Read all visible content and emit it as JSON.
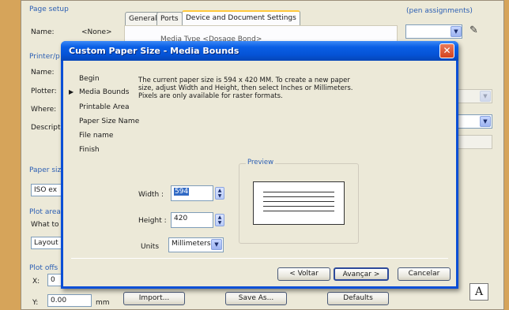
{
  "parent": {
    "page_setup": {
      "group_title": "Page setup",
      "name_label": "Name:",
      "name_value": "<None>"
    },
    "tabs": [
      "General",
      "Ports",
      "Device and Document Settings"
    ],
    "media_type_text": "Media Type <Dosage Bond>",
    "printer_group": {
      "title": "Printer/p",
      "name_label": "Name:",
      "plotter_label": "Plotter:",
      "where_label": "Where:",
      "description_label": "Descript"
    },
    "paper_size": {
      "title": "Paper siz",
      "value": "ISO ex"
    },
    "plot_area": {
      "title": "Plot area",
      "what_label": "What to",
      "value": "Layout"
    },
    "plot_offset": {
      "title": "Plot offs",
      "x_label": "X:",
      "x_value": "0",
      "y_label": "Y:",
      "y_value": "0.00",
      "unit": "mm"
    },
    "pen_assignments_title": "(pen assignments)",
    "buttons": {
      "import": "Import...",
      "save_as": "Save As...",
      "defaults": "Defaults"
    },
    "right_a_glyph": "A"
  },
  "dialog": {
    "title": "Custom Paper Size - Media Bounds",
    "close_glyph": "✕",
    "steps": [
      "Begin",
      "Media Bounds",
      "Printable Area",
      "Paper Size Name",
      "File name",
      "Finish"
    ],
    "current_step_arrow": "▶",
    "description": "The current paper size is 594 x 420 MM. To create a new paper size, adjust Width and Height, then select Inches or Millimeters. Pixels are only available for raster formats.",
    "width_label": "Width :",
    "width_value": "594",
    "height_label": "Height :",
    "height_value": "420",
    "units_label": "Units",
    "units_value": "Millimeters",
    "preview_label": "Preview",
    "buttons": {
      "back": "< Voltar",
      "next": "Avançar >",
      "cancel": "Cancelar"
    }
  },
  "colors": {
    "title_bar": "#0553d6",
    "dialog_bg": "#ece9d8",
    "group_title": "#2b5eb3",
    "close_button": "#d5431e",
    "selection": "#316ac5"
  },
  "icons": {
    "close": "close-icon",
    "dropdown": "chevron-down-icon",
    "spinner": "spinner-arrows-icon",
    "step_marker": "triangle-right-icon"
  }
}
